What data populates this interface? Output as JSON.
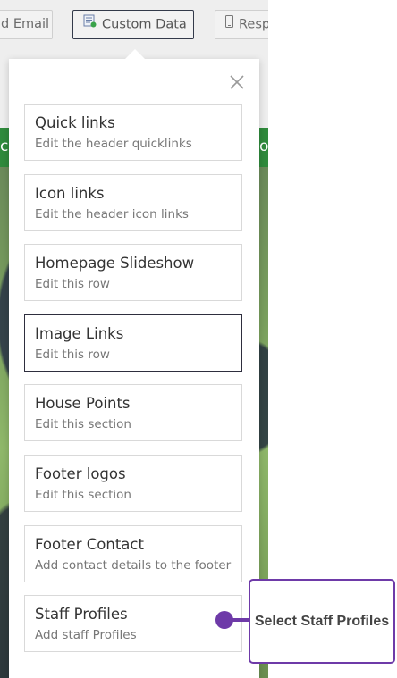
{
  "toolbar": {
    "buttons": [
      {
        "label": "d Email",
        "icon": null
      },
      {
        "label": "Custom Data",
        "icon": "custom-data-icon"
      },
      {
        "label": "Resp",
        "icon": "mobile-icon"
      }
    ]
  },
  "page": {
    "banner_left": "c",
    "banner_right": "o"
  },
  "popover": {
    "items": [
      {
        "title": "Quick links",
        "subtitle": "Edit the header quicklinks"
      },
      {
        "title": "Icon links",
        "subtitle": "Edit the header icon links"
      },
      {
        "title": "Homepage Slideshow",
        "subtitle": "Edit this row"
      },
      {
        "title": "Image Links",
        "subtitle": "Edit this row"
      },
      {
        "title": "House Points",
        "subtitle": "Edit this section"
      },
      {
        "title": "Footer logos",
        "subtitle": "Edit this section"
      },
      {
        "title": "Footer Contact",
        "subtitle": "Add contact details to the footer"
      },
      {
        "title": "Staff Profiles",
        "subtitle": "Add staff Profiles"
      }
    ]
  },
  "callout": {
    "text": "Select Staff Profiles",
    "color": "#6e3aa8"
  },
  "colors": {
    "banner_green": "#2f8a3c",
    "selected_border": "#2e2e3e"
  }
}
